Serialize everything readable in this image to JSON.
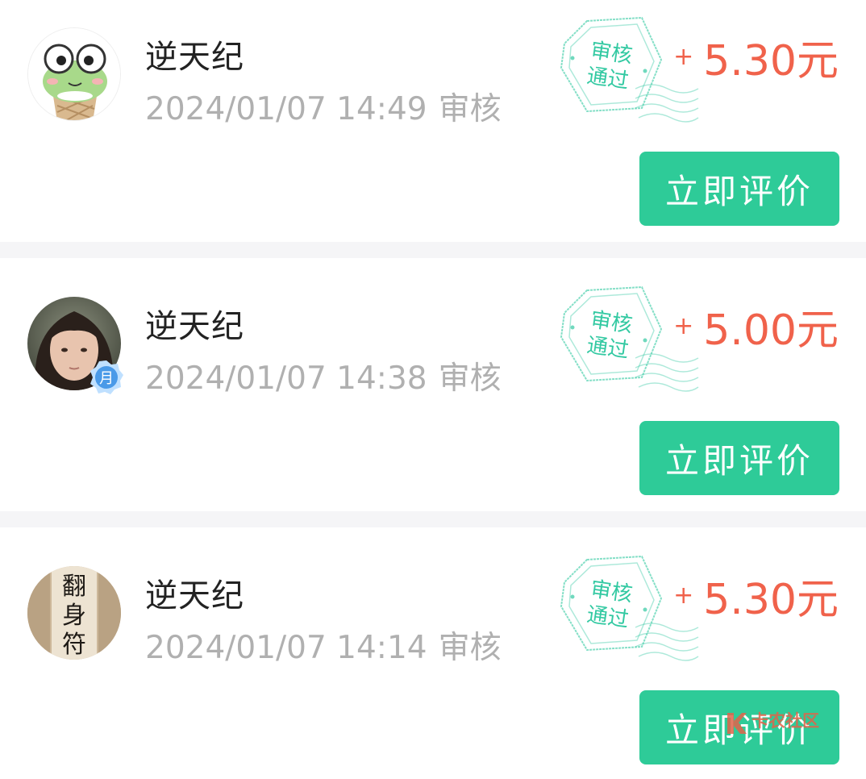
{
  "items": [
    {
      "name": "逆天纪",
      "date": "2024/01/07 14:49",
      "status": "审核",
      "stamp_line1": "审核",
      "stamp_line2": "通过",
      "plus": "+",
      "amount": "5.30元",
      "button": "立即评价",
      "avatar_icon": "frog-avatar"
    },
    {
      "name": "逆天纪",
      "date": "2024/01/07 14:38",
      "status": "审核",
      "stamp_line1": "审核",
      "stamp_line2": "通过",
      "plus": "+",
      "amount": "5.00元",
      "button": "立即评价",
      "avatar_icon": "girl-photo-avatar",
      "vip_badge": "月"
    },
    {
      "name": "逆天纪",
      "date": "2024/01/07 14:14",
      "status": "审核",
      "stamp_line1": "审核",
      "stamp_line2": "通过",
      "plus": "+",
      "amount": "5.30元",
      "button": "立即评价",
      "avatar_icon": "calligraphy-avatar",
      "avatar_text": "翻身符"
    }
  ],
  "watermark": "卡农社区",
  "colors": {
    "accent_green": "#2ecb98",
    "amount_red": "#f0624b",
    "stamp_teal": "#33c9a2",
    "meta_gray": "#b0b0b0"
  }
}
